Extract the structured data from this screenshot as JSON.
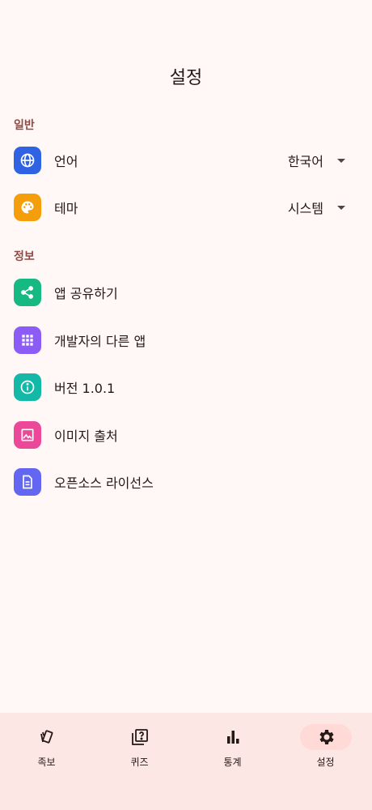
{
  "header": {
    "title": "설정"
  },
  "sections": {
    "general": "일반",
    "info": "정보"
  },
  "general": {
    "language": {
      "label": "언어",
      "value": "한국어",
      "icon": "globe-icon",
      "color": "#2f63e3"
    },
    "theme": {
      "label": "테마",
      "value": "시스템",
      "icon": "palette-icon",
      "color": "#f59e0b"
    }
  },
  "info": {
    "items": [
      {
        "label": "앱 공유하기",
        "icon": "share-icon",
        "color": "#16b981"
      },
      {
        "label": "개발자의 다른 앱",
        "icon": "apps-grid-icon",
        "color": "#8b5cf6"
      },
      {
        "label": "버전 1.0.1",
        "icon": "info-icon",
        "color": "#14b8a6"
      },
      {
        "label": "이미지 출처",
        "icon": "image-icon",
        "color": "#ec4899"
      },
      {
        "label": "오픈소스 라이선스",
        "icon": "document-icon",
        "color": "#6366f1"
      }
    ]
  },
  "nav": {
    "items": [
      {
        "label": "족보",
        "icon": "cards-icon"
      },
      {
        "label": "퀴즈",
        "icon": "quiz-icon"
      },
      {
        "label": "통계",
        "icon": "bar-chart-icon"
      },
      {
        "label": "설정",
        "icon": "gear-icon",
        "active": true
      }
    ]
  }
}
